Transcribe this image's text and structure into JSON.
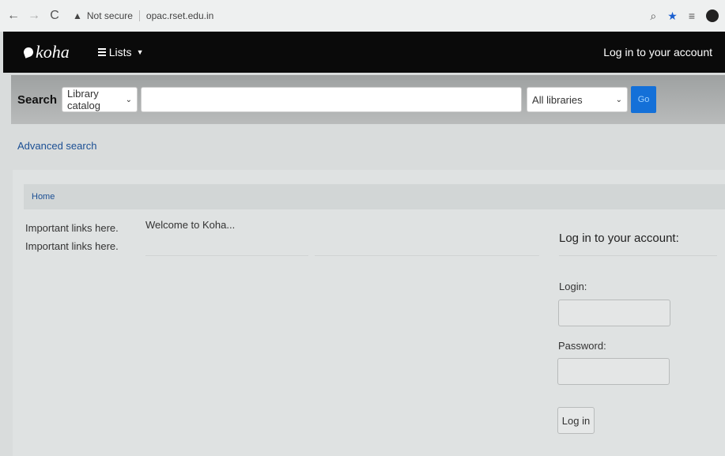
{
  "browser": {
    "security_label": "Not secure",
    "url": "opac.rset.edu.in"
  },
  "navbar": {
    "logo_text": "koha",
    "lists_label": "Lists",
    "login_link": "Log in to your account"
  },
  "search": {
    "label": "Search",
    "catalog_select": "Library catalog",
    "query_value": "",
    "library_select": "All libraries",
    "go_label": "Go"
  },
  "advanced_search": "Advanced search",
  "breadcrumb": {
    "home": "Home"
  },
  "links": [
    "Important links here.",
    "Important links here."
  ],
  "welcome": "Welcome to Koha...",
  "login_panel": {
    "title": "Log in to your account:",
    "login_label": "Login:",
    "password_label": "Password:",
    "button": "Log in"
  },
  "colors": {
    "navbar": "#0a0a0a",
    "go_button": "#1470d8",
    "link": "#1b4f94"
  }
}
